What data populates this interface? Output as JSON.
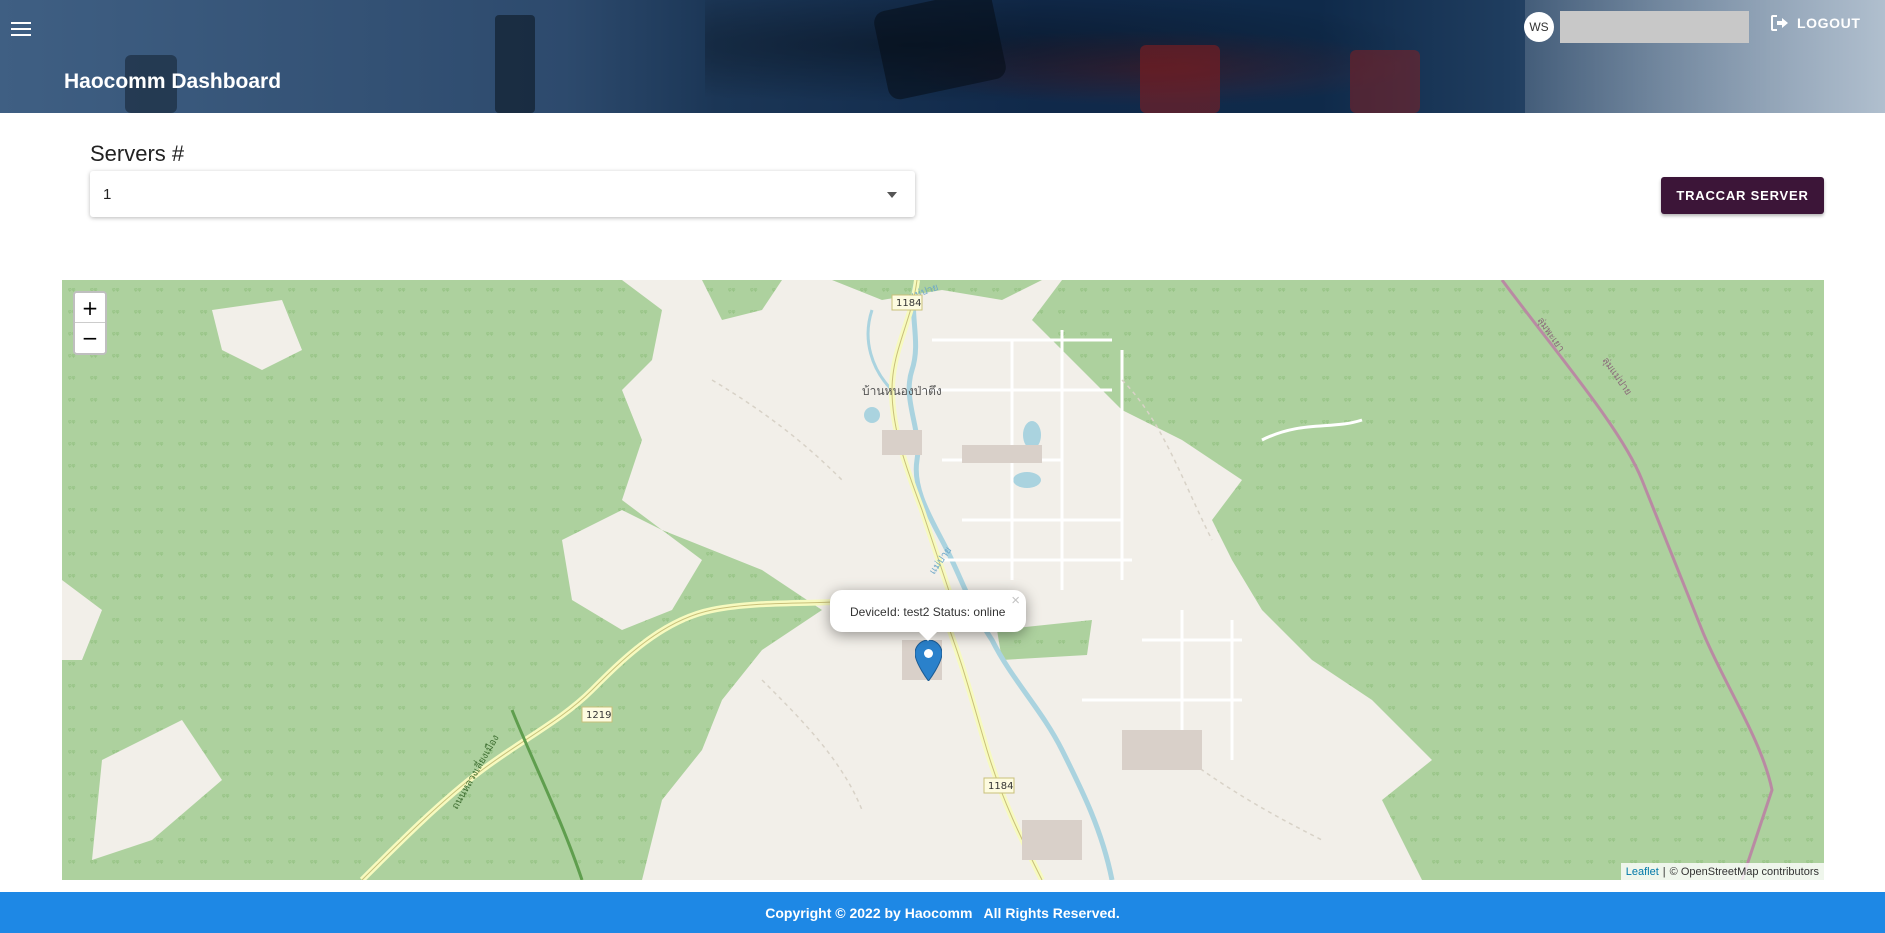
{
  "header": {
    "title": "Haocomm Dashboard",
    "avatar_initials": "WS",
    "logout_label": "LOGOUT"
  },
  "servers": {
    "label": "Servers #",
    "selected": "1",
    "traccar_button": "TRACCAR SERVER"
  },
  "map": {
    "zoom_in": "+",
    "zoom_out": "−",
    "popup_text": "DeviceId: test2 Status: online",
    "popup_close": "×",
    "attribution_leaflet": "Leaflet",
    "attribution_sep": "|",
    "attribution_osm": "© OpenStreetMap contributors",
    "labels": {
      "village": "บ้านหนองป่าตึง",
      "river_top": "แม่ปาย",
      "river_mid": "แม่ปาย",
      "route_1184_a": "1184",
      "route_1184_b": "1184",
      "route_1219": "1219",
      "rail_a": "ลุ่มพะเยา",
      "rail_b": "ลุ่มแม่ปาย",
      "road_sw": "ถนนหลวงเลี่ยงเมือง"
    }
  },
  "footer": {
    "copyright": "Copyright © 2022 by Haocomm   All Rights Reserved."
  }
}
